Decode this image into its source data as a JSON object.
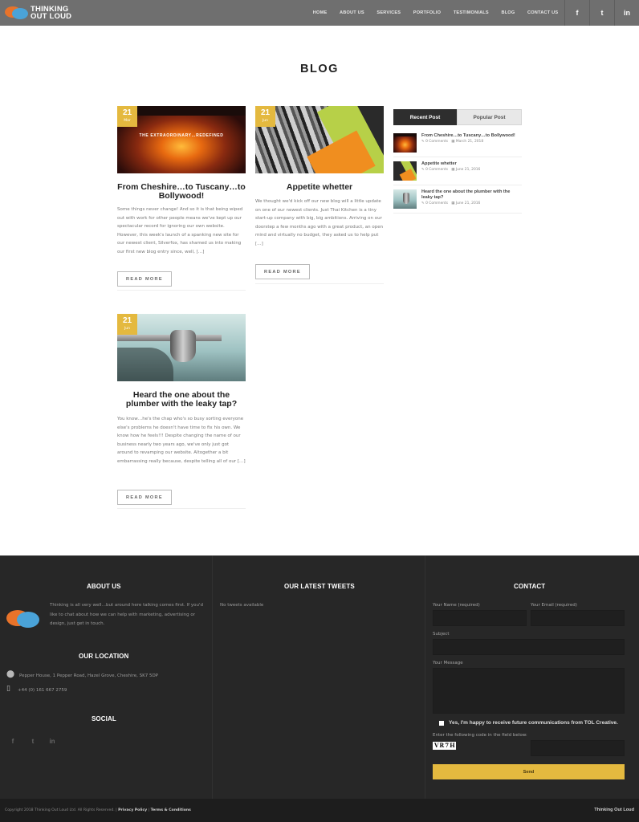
{
  "header": {
    "logo_line1": "THINKING",
    "logo_line2": "OUT LOUD",
    "nav": [
      "HOME",
      "ABOUT US",
      "SERVICES",
      "PORTFOLIO",
      "TESTIMONIALS",
      "BLOG",
      "CONTACT US"
    ],
    "social_icons": [
      "facebook-icon",
      "twitter-icon",
      "linkedin-icon"
    ],
    "social_glyphs": [
      "f",
      "t",
      "in"
    ]
  },
  "page_title": "BLOG",
  "posts": [
    {
      "day": "21",
      "month": "Mar",
      "title": "From Cheshire…to Tuscany…to Bollywood!",
      "thumb_caption": "THE EXTRAORDINARY…REDEFINED",
      "excerpt": "Some things never change! And so it is that being wiped out with work for other people means we've kept up our spectacular record for ignoring our own website. However, this week's launch of a spanking new site for our newest client, Silverfox, has shamed us into making our first new blog entry since, well, […]",
      "read_more": "READ MORE"
    },
    {
      "day": "21",
      "month": "Jun",
      "title": "Appetite whetter",
      "excerpt": "We thought we'd kick off our new blog will a little update on one of our newest clients. Just Thai Kitchen is a tiny start-up company with big, big ambitions. Arriving on our doorstep a few months ago with a great product, an open mind and virtually no budget, they asked us to help put […]",
      "read_more": "READ MORE"
    },
    {
      "day": "21",
      "month": "Jun",
      "title": "Heard the one about the plumber with the leaky tap?",
      "excerpt": "You know…he's the chap who's so busy sorting everyone else's problems he doesn't have time to fix his own. We know how he feels!!! Despite changing the name of our business nearly two years ago, we've only just got around to revamping our website. Altogether a bit embarrassing really because, despite telling all of our […]",
      "read_more": "READ MORE"
    }
  ],
  "sidebar": {
    "tabs": [
      "Recent Post",
      "Popular Post"
    ],
    "active_tab": "Recent Post",
    "recent_posts": [
      {
        "title": "From Cheshire…to Tuscany…to Bollywood!",
        "comments": "0 Comments",
        "date": "March 21, 2018"
      },
      {
        "title": "Appetite whetter",
        "comments": "0 Comments",
        "date": "June 21, 2016"
      },
      {
        "title": "Heard the one about the plumber with the leaky tap?",
        "comments": "0 Comments",
        "date": "June 21, 2016"
      }
    ]
  },
  "footer": {
    "about_heading": "ABOUT US",
    "about_text": "Thinking is all very well…but around here talking comes first. If you'd like to chat about how we can help with marketing, advertising or design, just get in touch.",
    "tweets_heading": "OUR LATEST TWEETS",
    "tweets_text": "No tweets available",
    "location_heading": "OUR LOCATION",
    "address": "Pepper House, 1 Pepper Road, Hazel Grove, Cheshire, SK7 5DP",
    "phone": "+44 (0) 161 667 2759",
    "social_heading": "SOCIAL",
    "social_icons": [
      "facebook-icon",
      "twitter-icon",
      "linkedin-icon"
    ],
    "social_glyphs": [
      "f",
      "t",
      "in"
    ],
    "contact_heading": "CONTACT",
    "form": {
      "name_label": "Your Name (required)",
      "email_label": "Your Email (required)",
      "subject_label": "Subject",
      "message_label": "Your Message",
      "consent_label": "Yes, I'm happy to receive future communications from TOL Creative.",
      "captcha_label": "Enter the following code in the field below:",
      "captcha_code": "VR7H",
      "send_label": "Send"
    },
    "copyright": "Copyright 2018 Thinking Out Loud Ltd. All Rights Reserved.",
    "privacy": "Privacy Policy",
    "terms": "Terms & Conditions",
    "brand": "Thinking Out Loud"
  },
  "colors": {
    "header_bg": "#6f6f6f",
    "accent": "#e4b93f",
    "footer_bg": "#272727"
  }
}
